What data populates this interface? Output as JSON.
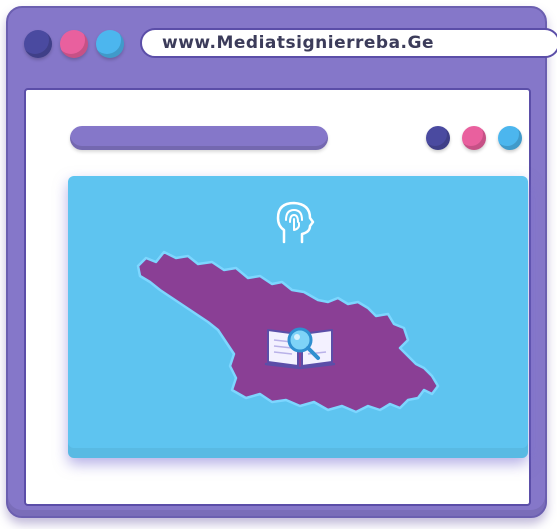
{
  "browser": {
    "url": "www.Mediatsignierreba.Ge",
    "window_controls": [
      {
        "name": "close",
        "color": "#4a4aa0"
      },
      {
        "name": "minimize",
        "color": "#e9609e"
      },
      {
        "name": "maximize",
        "color": "#4cb6ee"
      }
    ]
  },
  "content": {
    "toolbar_dots": [
      {
        "color": "#4a4aa0"
      },
      {
        "color": "#e9609e"
      },
      {
        "color": "#4cb6ee"
      }
    ],
    "hero": {
      "background": "#5ec4f0",
      "icons": [
        "head-touch-icon",
        "georgia-map",
        "book-magnifier-icon"
      ]
    }
  },
  "colors": {
    "frame": "#8577c9",
    "map_fill": "#8a3f95",
    "accent_blue": "#4cb6ee",
    "accent_pink": "#e9609e"
  }
}
